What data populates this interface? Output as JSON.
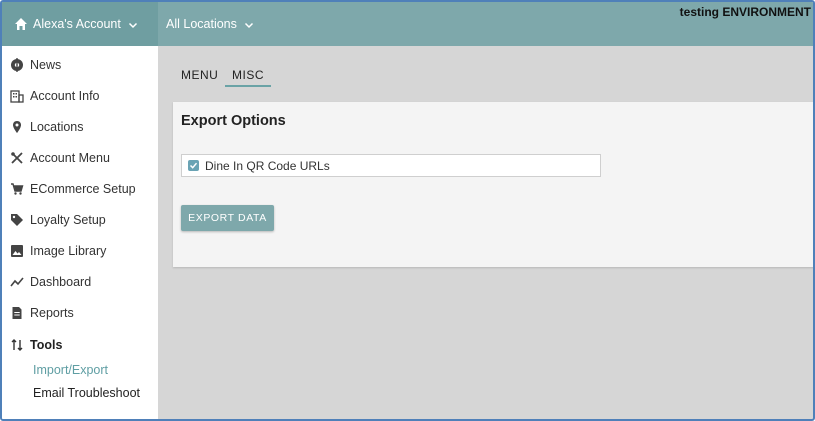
{
  "header": {
    "account_label": "Alexa's Account",
    "locations_label": "All Locations",
    "environment_label": "testing ENVIRONMENT"
  },
  "sidebar": {
    "items": [
      {
        "label": "News",
        "icon": "gear-badge-icon"
      },
      {
        "label": "Account Info",
        "icon": "building-icon"
      },
      {
        "label": "Locations",
        "icon": "map-pin-icon"
      },
      {
        "label": "Account Menu",
        "icon": "utensils-icon"
      },
      {
        "label": "ECommerce Setup",
        "icon": "cart-icon"
      },
      {
        "label": "Loyalty Setup",
        "icon": "tag-icon"
      },
      {
        "label": "Image Library",
        "icon": "image-icon"
      },
      {
        "label": "Dashboard",
        "icon": "trend-line-icon"
      },
      {
        "label": "Reports",
        "icon": "document-icon"
      },
      {
        "label": "Tools",
        "icon": "sort-arrows-icon"
      }
    ],
    "tools_sub": [
      {
        "label": "Import/Export",
        "active": true
      },
      {
        "label": "Email Troubleshoot",
        "active": false
      }
    ]
  },
  "main": {
    "tabs": [
      {
        "label": "MENU",
        "active": false
      },
      {
        "label": "MISC",
        "active": true
      }
    ],
    "card": {
      "title": "Export Options",
      "option_label": "Dine In QR Code URLs",
      "option_checked": true,
      "button_label": "EXPORT DATA"
    }
  },
  "colors": {
    "header": "#7ea8ab",
    "accent": "#6aa3a6",
    "active_link": "#5f9ea3"
  }
}
